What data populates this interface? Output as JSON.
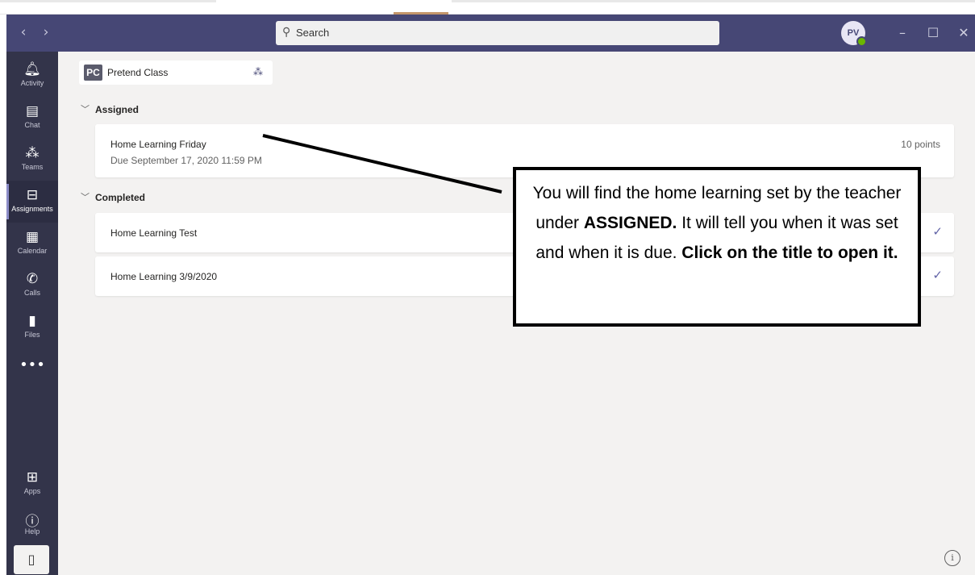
{
  "titlebar": {
    "back_icon": "chevron-left-icon",
    "forward_icon": "chevron-right-icon",
    "search_placeholder": "Search",
    "avatar_initials": "PV",
    "minimize_icon": "minimize-icon",
    "maximize_icon": "maximize-icon",
    "close_icon": "close-icon",
    "colors": {
      "titlebar": "#464775",
      "presence": "#6bb700"
    }
  },
  "rail": {
    "items": [
      {
        "label": "Activity",
        "icon": "bell-icon"
      },
      {
        "label": "Chat",
        "icon": "chat-icon"
      },
      {
        "label": "Teams",
        "icon": "teams-icon"
      },
      {
        "label": "Assignments",
        "icon": "assignments-icon",
        "active": true
      },
      {
        "label": "Calendar",
        "icon": "calendar-icon"
      },
      {
        "label": "Calls",
        "icon": "phone-icon"
      },
      {
        "label": "Files",
        "icon": "file-icon"
      }
    ],
    "more_icon": "more-icon",
    "apps_label": "Apps",
    "help_label": "Help",
    "device_icon": "mobile-device-icon",
    "colors": {
      "rail": "#33344a",
      "active_bar": "#8b8cc7"
    }
  },
  "class": {
    "badge": "PC",
    "name": "Pretend Class"
  },
  "sections": {
    "assigned": {
      "heading": "Assigned",
      "items": [
        {
          "title": "Home Learning Friday",
          "due": "Due September 17, 2020 11:59 PM",
          "points": "10 points"
        }
      ]
    },
    "completed": {
      "heading": "Completed",
      "items": [
        {
          "title": "Home Learning Test"
        },
        {
          "title": "Home Learning 3/9/2020"
        }
      ]
    }
  },
  "callout": {
    "part1": "You will find the home learning set by the teacher under ",
    "bold1": "ASSIGNED.",
    "part2": " It will tell you when it was set and when it is due. ",
    "bold2": "Click on the title to open it."
  }
}
